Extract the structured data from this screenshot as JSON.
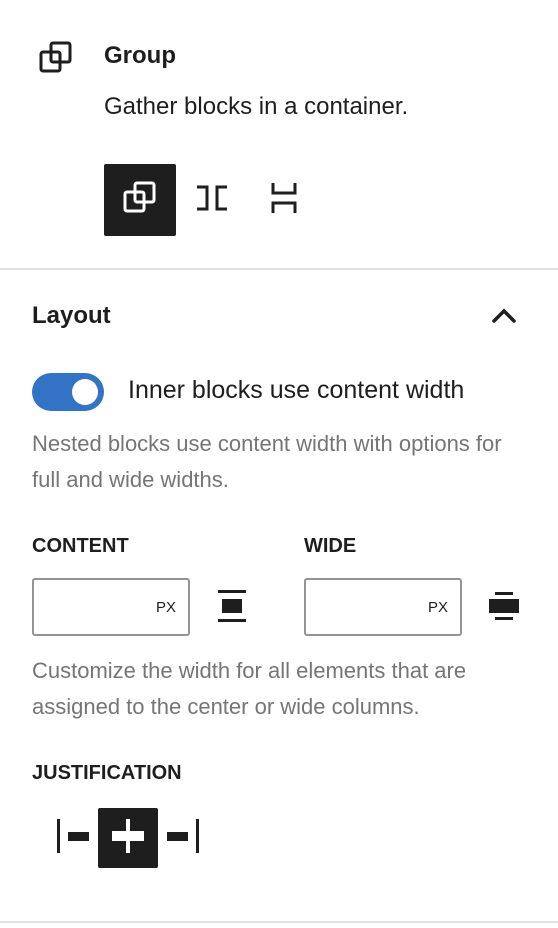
{
  "block": {
    "title": "Group",
    "description": "Gather blocks in a container.",
    "icon": "group-icon"
  },
  "variations": [
    {
      "name": "Group",
      "icon": "group-icon",
      "active": true
    },
    {
      "name": "Row",
      "icon": "row-icon",
      "active": false
    },
    {
      "name": "Stack",
      "icon": "stack-icon",
      "active": false
    }
  ],
  "layout": {
    "title": "Layout",
    "expanded": true,
    "toggle": {
      "label": "Inner blocks use content width",
      "checked": true,
      "help": "Nested blocks use content width with options for full and wide widths."
    },
    "content": {
      "label": "CONTENT",
      "value": "",
      "unit": "PX"
    },
    "wide": {
      "label": "WIDE",
      "value": "",
      "unit": "PX"
    },
    "width_help": "Customize the width for all elements that are assigned to the center or wide columns.",
    "justification": {
      "label": "JUSTIFICATION",
      "options": [
        {
          "name": "left",
          "icon": "justify-left-icon",
          "active": false
        },
        {
          "name": "center",
          "icon": "justify-center-icon",
          "active": true
        },
        {
          "name": "right",
          "icon": "justify-right-icon",
          "active": false
        }
      ]
    }
  },
  "colors": {
    "accent": "#3273c5",
    "text": "#1e1e1e",
    "muted": "#757575",
    "border": "#949494",
    "divider": "#e0e0e0"
  }
}
